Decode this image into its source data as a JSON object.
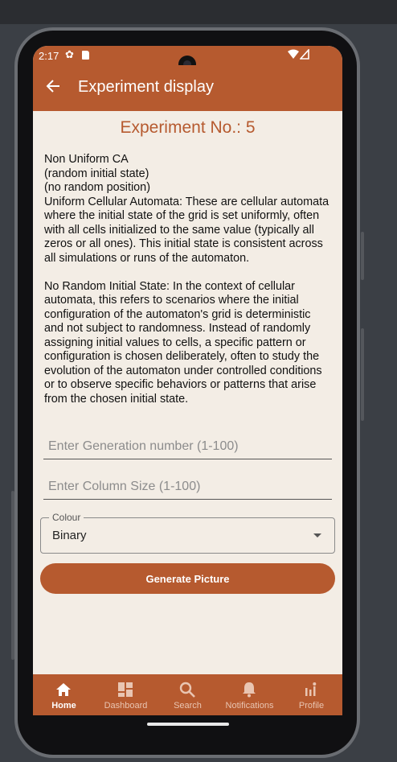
{
  "status_bar": {
    "time": "2:17"
  },
  "app_bar": {
    "title": "Experiment display"
  },
  "heading": "Experiment No.: 5",
  "description": "Non Uniform CA\n(random initial state)\n(no random position)\nUniform Cellular Automata: These are cellular automata where the initial state of the grid is set uniformly, often with all cells initialized to the same value (typically all zeros or all ones). This initial state is consistent across all simulations or runs of the automaton.\n\nNo Random Initial State: In the context of cellular automata, this refers to scenarios where the initial configuration of the automaton's grid is deterministic and not subject to randomness. Instead of randomly assigning initial values to cells, a specific pattern or configuration is chosen deliberately, often to study the evolution of the automaton under controlled conditions or to observe specific behaviors or patterns that arise from the chosen initial state.",
  "form": {
    "generation_placeholder": "Enter Generation number (1-100)",
    "generation_value": "",
    "column_placeholder": "Enter Column Size (1-100)",
    "column_value": "",
    "colour_label": "Colour",
    "colour_value": "Binary",
    "generate_label": "Generate Picture"
  },
  "bottom_nav": {
    "items": [
      {
        "label": "Home",
        "icon": "home-icon",
        "active": true
      },
      {
        "label": "Dashboard",
        "icon": "dashboard-icon",
        "active": false
      },
      {
        "label": "Search",
        "icon": "search-icon",
        "active": false
      },
      {
        "label": "Notifications",
        "icon": "bell-icon",
        "active": false
      },
      {
        "label": "Profile",
        "icon": "profile-icon",
        "active": false
      }
    ]
  },
  "colors": {
    "accent": "#b65a2f",
    "background": "#f3ede5"
  }
}
